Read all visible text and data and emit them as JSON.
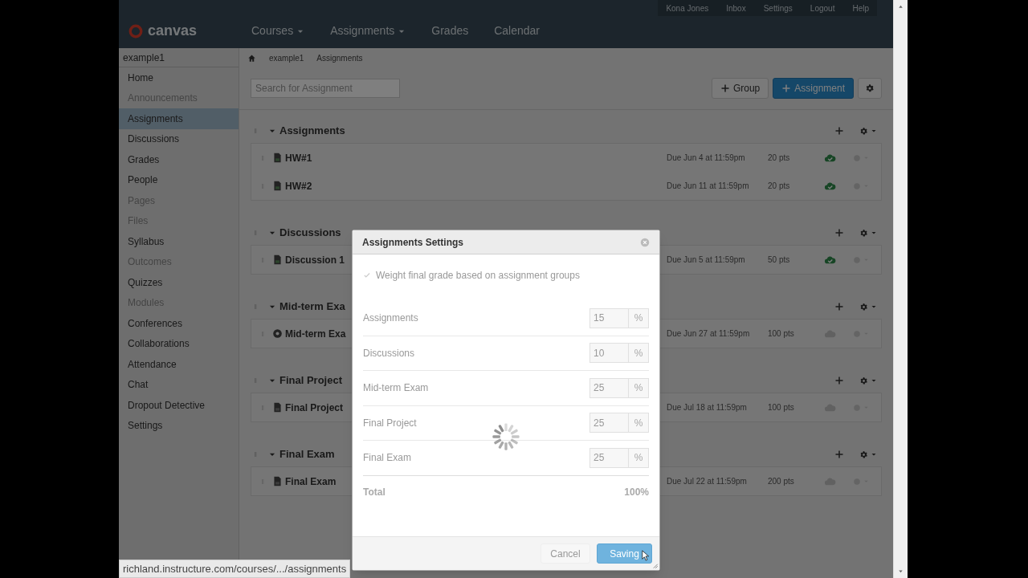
{
  "header": {
    "logo": "canvas",
    "user_links": [
      "Kona Jones",
      "Inbox",
      "Settings",
      "Logout",
      "Help"
    ],
    "nav": [
      {
        "label": "Courses",
        "dropdown": true
      },
      {
        "label": "Assignments",
        "dropdown": true
      },
      {
        "label": "Grades",
        "dropdown": false
      },
      {
        "label": "Calendar",
        "dropdown": false
      }
    ]
  },
  "sidebar": {
    "course": "example1",
    "items": [
      {
        "label": "Home",
        "selected": false,
        "hidden": false
      },
      {
        "label": "Announcements",
        "selected": false,
        "hidden": true
      },
      {
        "label": "Assignments",
        "selected": true,
        "hidden": false
      },
      {
        "label": "Discussions",
        "selected": false,
        "hidden": false
      },
      {
        "label": "Grades",
        "selected": false,
        "hidden": false
      },
      {
        "label": "People",
        "selected": false,
        "hidden": false
      },
      {
        "label": "Pages",
        "selected": false,
        "hidden": true
      },
      {
        "label": "Files",
        "selected": false,
        "hidden": true
      },
      {
        "label": "Syllabus",
        "selected": false,
        "hidden": false
      },
      {
        "label": "Outcomes",
        "selected": false,
        "hidden": true
      },
      {
        "label": "Quizzes",
        "selected": false,
        "hidden": false
      },
      {
        "label": "Modules",
        "selected": false,
        "hidden": true
      },
      {
        "label": "Conferences",
        "selected": false,
        "hidden": false
      },
      {
        "label": "Collaborations",
        "selected": false,
        "hidden": false
      },
      {
        "label": "Attendance",
        "selected": false,
        "hidden": false
      },
      {
        "label": "Chat",
        "selected": false,
        "hidden": false
      },
      {
        "label": "Dropout Detective",
        "selected": false,
        "hidden": false
      },
      {
        "label": "Settings",
        "selected": false,
        "hidden": false
      }
    ]
  },
  "breadcrumb": [
    "example1",
    "Assignments"
  ],
  "toolbar": {
    "search": {
      "placeholder": "Search for Assignment"
    },
    "buttons": [
      {
        "label": "Group",
        "kind": "default"
      },
      {
        "label": "Assignment",
        "kind": "primary"
      }
    ]
  },
  "groups": [
    {
      "title": "Assignments",
      "items": [
        {
          "kind": "assignment",
          "name": "HW#1",
          "due": "Due Jun 4 at 11:59pm",
          "points": "20 pts",
          "published": true
        },
        {
          "kind": "assignment",
          "name": "HW#2",
          "due": "Due Jun 11 at 11:59pm",
          "points": "20 pts",
          "published": true
        }
      ]
    },
    {
      "title": "Discussions",
      "items": [
        {
          "kind": "assignment",
          "name": "Discussion 1",
          "due": "Due Jun 5 at 11:59pm",
          "points": "50 pts",
          "published": true
        }
      ]
    },
    {
      "title": "Mid-term Exa",
      "items": [
        {
          "kind": "quiz",
          "name": "Mid-term Exa",
          "due": "Due Jun 27 at 11:59pm",
          "points": "100 pts",
          "published": false
        }
      ]
    },
    {
      "title": "Final Project",
      "items": [
        {
          "kind": "assignment",
          "name": "Final Project",
          "due": "Due Jul 18 at 11:59pm",
          "points": "100 pts",
          "published": false
        }
      ]
    },
    {
      "title": "Final Exam",
      "items": [
        {
          "kind": "assignment",
          "name": "Final Exam",
          "due": "Due Jul 22 at 11:59pm",
          "points": "200 pts",
          "published": false
        }
      ]
    }
  ],
  "dialog": {
    "title": "Assignments Settings",
    "weight_option": {
      "label": "Weight final grade based on assignment groups",
      "checked": true
    },
    "weights": [
      {
        "group": "Assignments",
        "value": "15",
        "unit": "%"
      },
      {
        "group": "Discussions",
        "value": "10",
        "unit": "%"
      },
      {
        "group": "Mid-term Exam",
        "value": "25",
        "unit": "%"
      },
      {
        "group": "Final Project",
        "value": "25",
        "unit": "%"
      },
      {
        "group": "Final Exam",
        "value": "25",
        "unit": "%"
      }
    ],
    "total_label": "Total",
    "total": "100%",
    "loading": true,
    "buttons": [
      {
        "label": "Cancel",
        "kind": "cancel"
      },
      {
        "label": "Saving",
        "kind": "primary"
      }
    ]
  },
  "status_url": "richland.instructure.com/courses/.../assignments"
}
